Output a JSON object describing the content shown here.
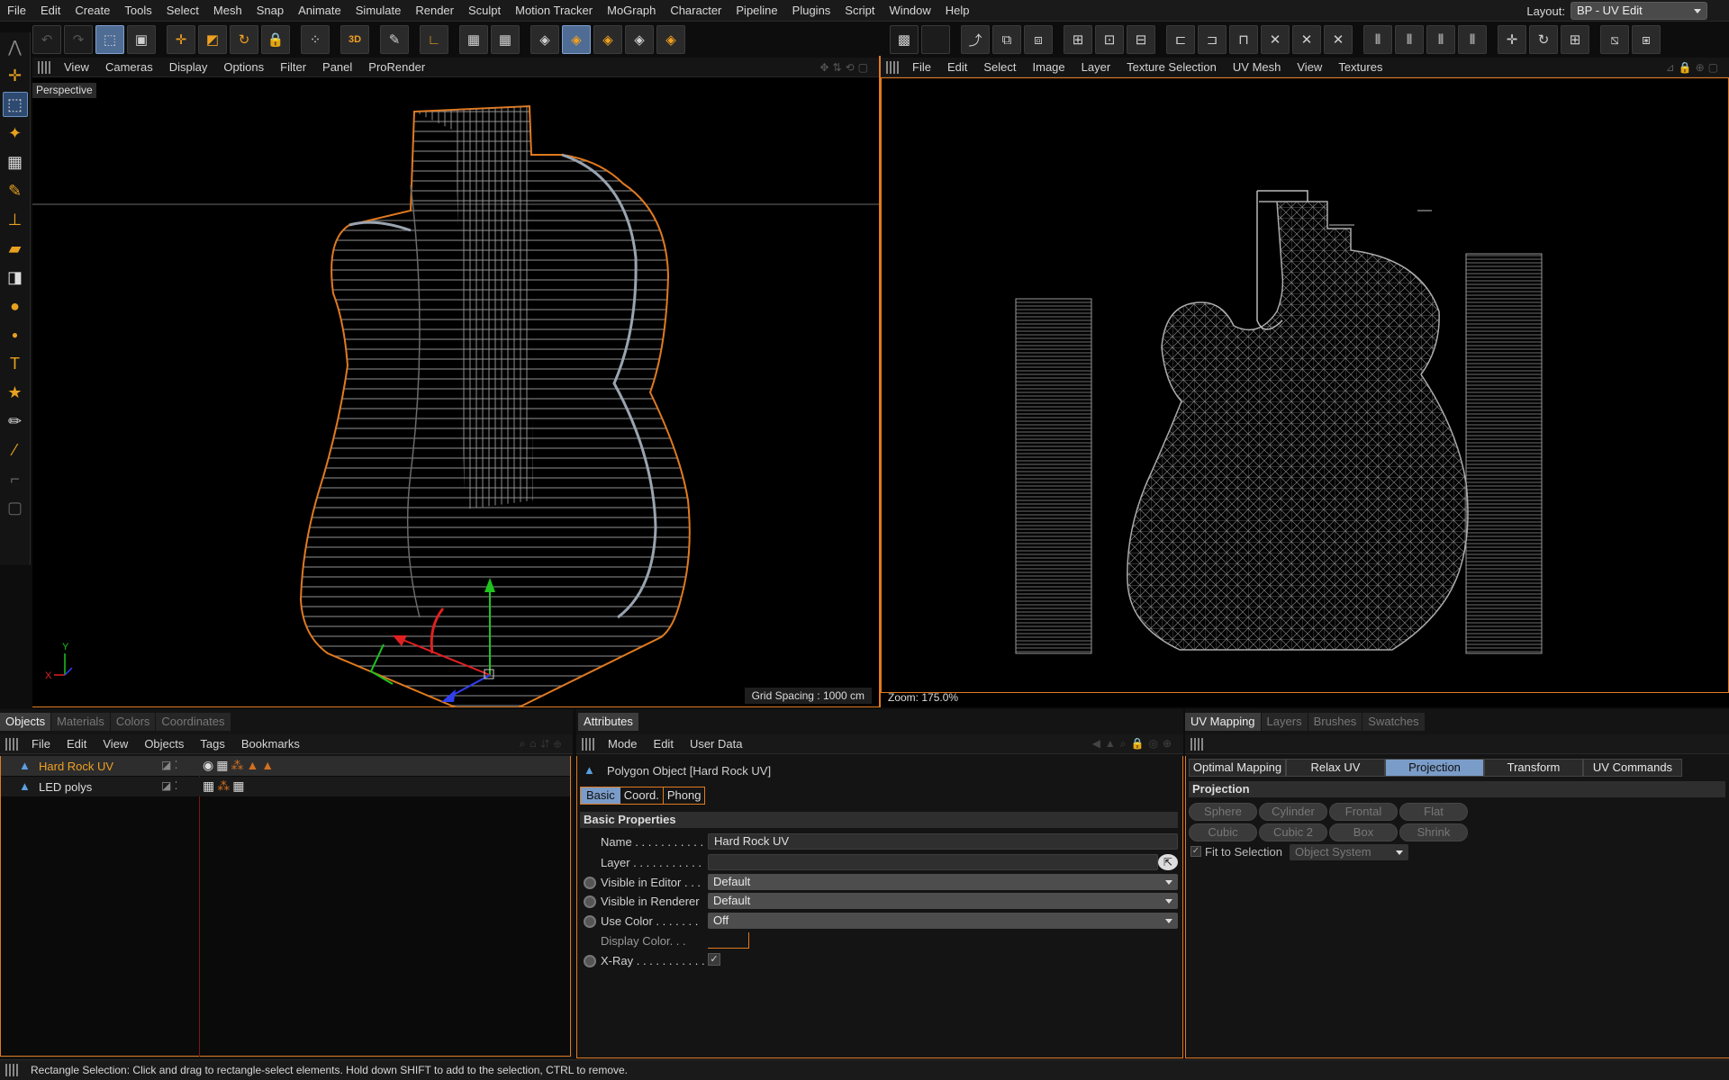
{
  "menubar": {
    "items": [
      "File",
      "Edit",
      "Create",
      "Tools",
      "Select",
      "Mesh",
      "Snap",
      "Animate",
      "Simulate",
      "Render",
      "Sculpt",
      "Motion Tracker",
      "MoGraph",
      "Character",
      "Pipeline",
      "Plugins",
      "Script",
      "Window",
      "Help"
    ],
    "layout_label": "Layout:",
    "layout_value": "BP - UV Edit"
  },
  "viewport_left": {
    "menu": [
      "View",
      "Cameras",
      "Display",
      "Options",
      "Filter",
      "Panel",
      "ProRender"
    ],
    "label": "Perspective",
    "grid_spacing": "Grid Spacing : 1000 cm"
  },
  "viewport_right": {
    "menu": [
      "File",
      "Edit",
      "Select",
      "Image",
      "Layer",
      "Texture Selection",
      "UV Mesh",
      "View",
      "Textures"
    ],
    "zoom": "Zoom: 175.0%"
  },
  "objects": {
    "tabs": [
      "Objects",
      "Materials",
      "Colors",
      "Coordinates"
    ],
    "menu": [
      "File",
      "Edit",
      "View",
      "Objects",
      "Tags",
      "Bookmarks"
    ],
    "items": [
      {
        "name": "Hard Rock UV",
        "selected": true
      },
      {
        "name": "LED polys",
        "selected": false
      }
    ]
  },
  "attributes": {
    "tab": "Attributes",
    "menu": [
      "Mode",
      "Edit",
      "User Data"
    ],
    "object_title": "Polygon Object [Hard Rock UV]",
    "subtabs": [
      "Basic",
      "Coord.",
      "Phong"
    ],
    "section": "Basic Properties",
    "name_label": "Name . . . . . . . . . . .",
    "name_value": "Hard Rock UV",
    "layer_label": "Layer . . . . . . . . . . .",
    "visible_editor_label": "Visible in Editor . . .",
    "visible_editor_value": "Default",
    "visible_renderer_label": "Visible in Renderer",
    "visible_renderer_value": "Default",
    "use_color_label": "Use Color . . . . . . .",
    "use_color_value": "Off",
    "display_color_label": "Display Color. . .",
    "xray_label": "X-Ray . . . . . . . . . . .",
    "accent": "#e07a20"
  },
  "uv": {
    "tabs": [
      "UV Mapping",
      "Layers",
      "Brushes",
      "Swatches"
    ],
    "subtabs": [
      "Optimal Mapping",
      "Relax UV",
      "Projection",
      "Transform",
      "UV Commands"
    ],
    "section": "Projection",
    "buttons_row1": [
      "Sphere",
      "Cylinder",
      "Frontal",
      "Flat"
    ],
    "buttons_row2": [
      "Cubic",
      "Cubic 2",
      "Box",
      "Shrink"
    ],
    "fit_label": "Fit to Selection",
    "fit_select": "Object System"
  },
  "status": "Rectangle Selection: Click and drag to rectangle-select elements. Hold down SHIFT to add to the selection, CTRL to remove."
}
